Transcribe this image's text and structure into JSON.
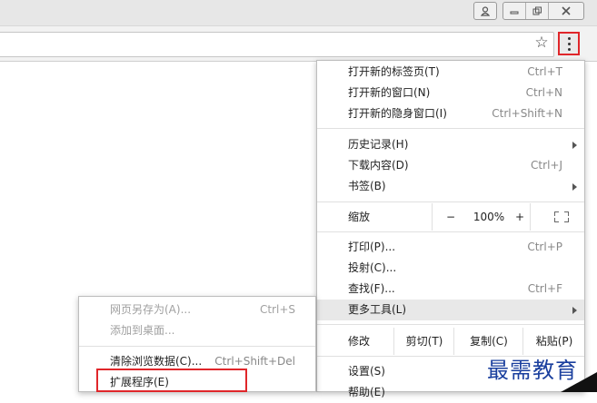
{
  "window_controls": {
    "user_icon": "user-icon",
    "minimize_icon": "minimize-icon",
    "restore_icon": "restore-icon",
    "close_icon": "close-icon"
  },
  "toolbar": {
    "bookmark_icon": "star-icon",
    "menu_icon": "three-dots-vertical-icon",
    "highlight_color": "#e0262a"
  },
  "menu": {
    "new_tab": {
      "label": "打开新的标签页(T)",
      "shortcut": "Ctrl+T"
    },
    "new_window": {
      "label": "打开新的窗口(N)",
      "shortcut": "Ctrl+N"
    },
    "new_incognito": {
      "label": "打开新的隐身窗口(I)",
      "shortcut": "Ctrl+Shift+N"
    },
    "history": {
      "label": "历史记录(H)"
    },
    "downloads": {
      "label": "下载内容(D)",
      "shortcut": "Ctrl+J"
    },
    "bookmarks": {
      "label": "书签(B)"
    },
    "zoom": {
      "label": "缩放",
      "minus": "−",
      "value": "100%",
      "plus": "+",
      "fullscreen_icon": "fullscreen-icon"
    },
    "print": {
      "label": "打印(P)...",
      "shortcut": "Ctrl+P"
    },
    "cast": {
      "label": "投射(C)..."
    },
    "find": {
      "label": "查找(F)...",
      "shortcut": "Ctrl+F"
    },
    "more_tools": {
      "label": "更多工具(L)"
    },
    "edit": {
      "label": "修改",
      "cut": "剪切(T)",
      "copy": "复制(C)",
      "paste": "粘贴(P)"
    },
    "settings": {
      "label": "设置(S)"
    },
    "help": {
      "label": "帮助(E)"
    }
  },
  "submenu": {
    "save_page": {
      "label": "网页另存为(A)...",
      "shortcut": "Ctrl+S"
    },
    "add_to_desktop": {
      "label": "添加到桌面..."
    },
    "clear_data": {
      "label": "清除浏览数据(C)...",
      "shortcut": "Ctrl+Shift+Del"
    },
    "extensions": {
      "label": "扩展程序(E)"
    }
  },
  "watermark": {
    "text": "最需教育"
  }
}
